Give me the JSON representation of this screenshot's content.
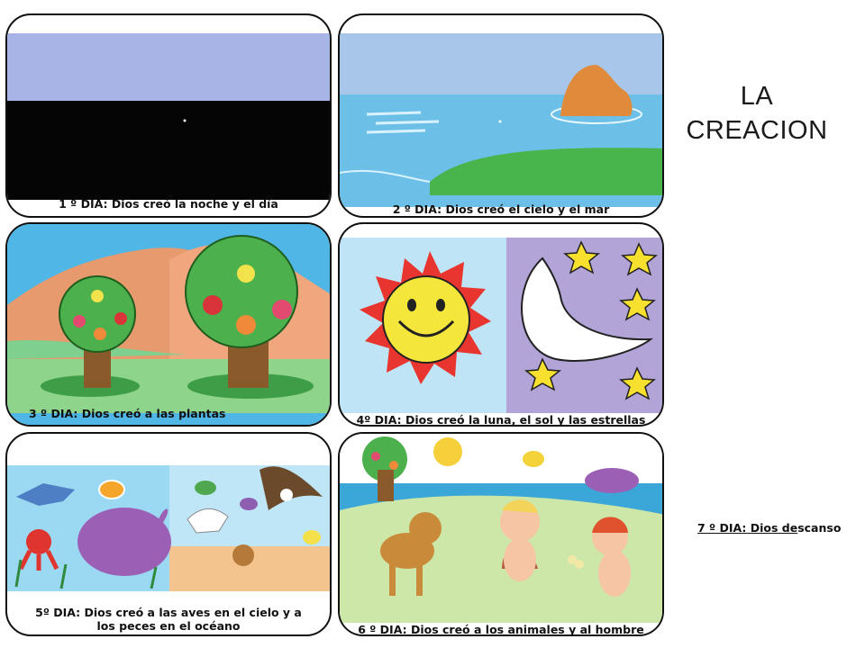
{
  "title": {
    "line1": "LA",
    "line2": "CREACION"
  },
  "days": [
    {
      "caption": "1 º DIA:  Dios creó la noche y el día"
    },
    {
      "caption": "2 º DIA:  Dios creó el cielo y el mar"
    },
    {
      "caption": "3 º DIA: Dios creó a las plantas"
    },
    {
      "caption": "4º DIA: Dios creó la luna, el sol y las estrellas"
    },
    {
      "caption": "5º DIA: Dios creó  a las aves en el cielo y a los peces en el océano"
    },
    {
      "caption": "6 º DIA: Dios creó a los animales y al hombre"
    }
  ],
  "day7": {
    "prefix": "7 º DIA: Dios de",
    "rest": "scanso"
  }
}
